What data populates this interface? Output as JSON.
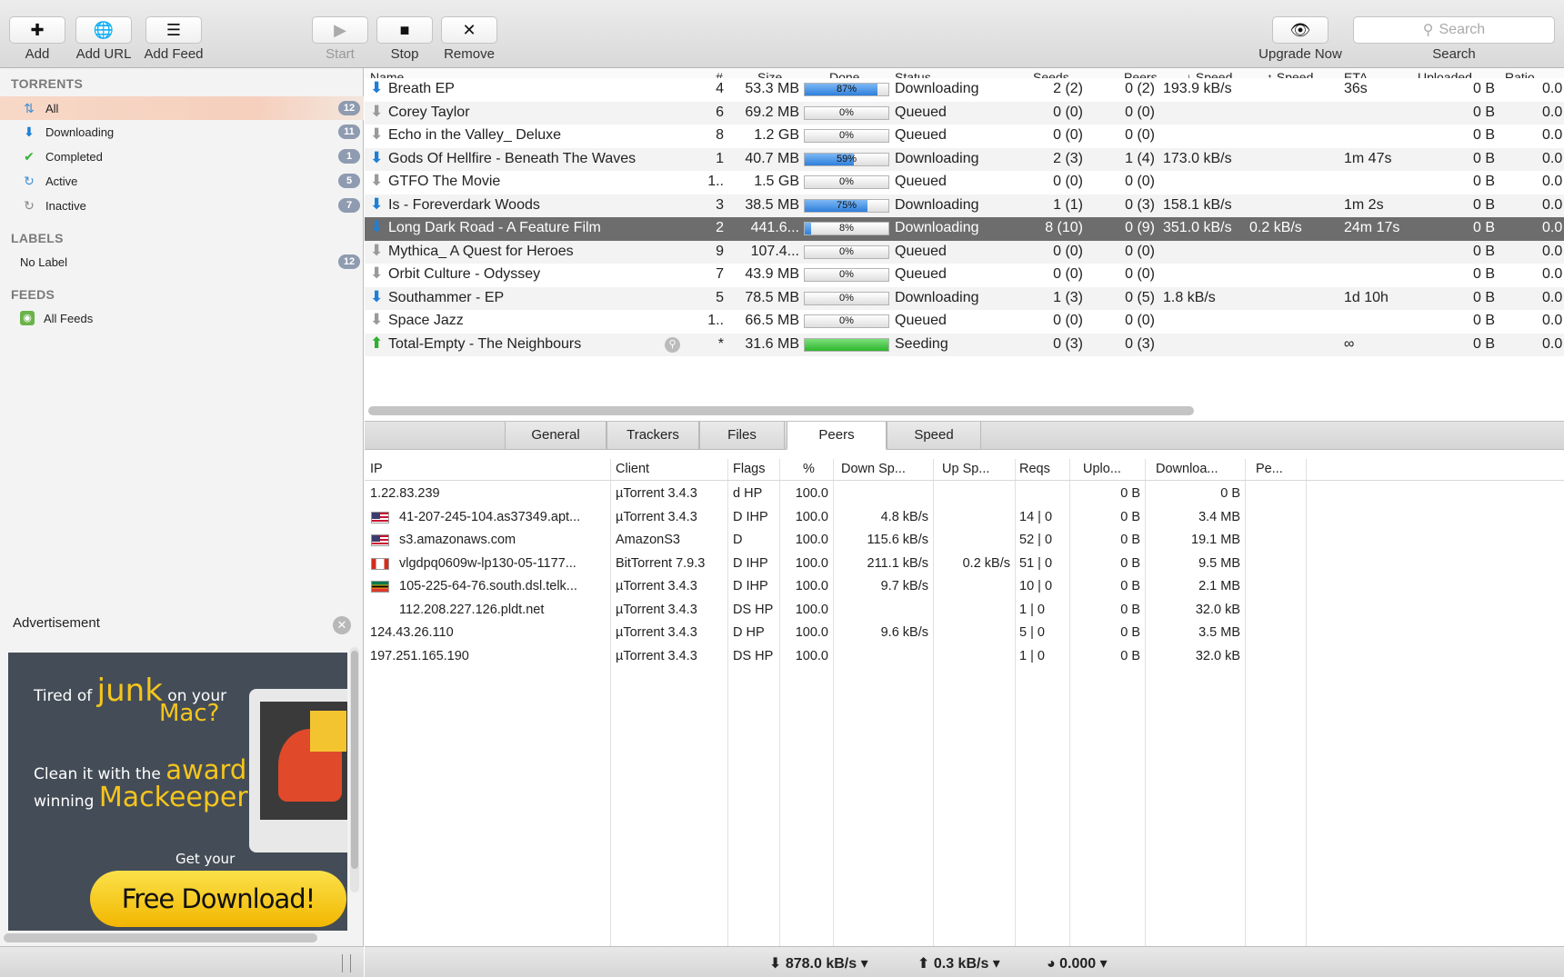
{
  "toolbar": {
    "add": "Add",
    "add_url": "Add URL",
    "add_feed": "Add Feed",
    "start": "Start",
    "stop": "Stop",
    "remove": "Remove",
    "upgrade": "Upgrade Now",
    "search_placeholder": "Search",
    "search_label": "Search"
  },
  "sidebar": {
    "torrents_header": "TORRENTS",
    "items": [
      {
        "label": "All",
        "count": "12",
        "icon": "all-arrows-icon"
      },
      {
        "label": "Downloading",
        "count": "11",
        "icon": "download-arrow-icon"
      },
      {
        "label": "Completed",
        "count": "1",
        "icon": "checkmark-icon"
      },
      {
        "label": "Active",
        "count": "5",
        "icon": "active-refresh-icon"
      },
      {
        "label": "Inactive",
        "count": "7",
        "icon": "inactive-refresh-icon"
      }
    ],
    "labels_header": "LABELS",
    "no_label": "No Label",
    "no_label_count": "12",
    "feeds_header": "FEEDS",
    "all_feeds": "All Feeds",
    "ad_label": "Advertisement",
    "ad": {
      "line1a": "Tired of",
      "line1b": "junk",
      "line1c": "on your",
      "line2": "Mac?",
      "line3a": "Clean it with the",
      "line3b": "award",
      "line4a": "winning",
      "line4b": "Mackeeper",
      "line5": "Get your",
      "button": "Free Download!"
    }
  },
  "torrents": {
    "headers": {
      "name": "Name",
      "num": "#",
      "size": "Size",
      "done": "Done",
      "status": "Status",
      "seeds": "Seeds",
      "peers": "Peers",
      "down": "↓ Speed",
      "up": "↑ Speed",
      "eta": "ETA",
      "uploaded": "Uploaded",
      "ratio": "Ratio"
    },
    "rows": [
      {
        "dir": "down",
        "name": "Breath EP",
        "num": "4",
        "size": "53.3 MB",
        "done": 87,
        "done_text": "87%",
        "status": "Downloading",
        "seeds": "2 (2)",
        "peers": "0 (2)",
        "down": "193.9 kB/s",
        "up": "",
        "eta": "36s",
        "uploaded": "0 B",
        "ratio": "0.0"
      },
      {
        "dir": "q",
        "name": "Corey Taylor",
        "num": "6",
        "size": "69.2 MB",
        "done": 0,
        "done_text": "0%",
        "status": "Queued",
        "seeds": "0 (0)",
        "peers": "0 (0)",
        "down": "",
        "up": "",
        "eta": "",
        "uploaded": "0 B",
        "ratio": "0.0"
      },
      {
        "dir": "q",
        "name": "Echo in the Valley_ Deluxe",
        "num": "8",
        "size": "1.2 GB",
        "done": 0,
        "done_text": "0%",
        "status": "Queued",
        "seeds": "0 (0)",
        "peers": "0 (0)",
        "down": "",
        "up": "",
        "eta": "",
        "uploaded": "0 B",
        "ratio": "0.0"
      },
      {
        "dir": "down",
        "name": "Gods Of Hellfire - Beneath The Waves",
        "num": "1",
        "size": "40.7 MB",
        "done": 59,
        "done_text": "59%",
        "status": "Downloading",
        "seeds": "2 (3)",
        "peers": "1 (4)",
        "down": "173.0 kB/s",
        "up": "",
        "eta": "1m 47s",
        "uploaded": "0 B",
        "ratio": "0.0"
      },
      {
        "dir": "q",
        "name": "GTFO The Movie",
        "num": "1..",
        "size": "1.5 GB",
        "done": 0,
        "done_text": "0%",
        "status": "Queued",
        "seeds": "0 (0)",
        "peers": "0 (0)",
        "down": "",
        "up": "",
        "eta": "",
        "uploaded": "0 B",
        "ratio": "0.0"
      },
      {
        "dir": "down",
        "name": "Is - Foreverdark Woods",
        "num": "3",
        "size": "38.5 MB",
        "done": 75,
        "done_text": "75%",
        "status": "Downloading",
        "seeds": "1 (1)",
        "peers": "0 (3)",
        "down": "158.1 kB/s",
        "up": "",
        "eta": "1m 2s",
        "uploaded": "0 B",
        "ratio": "0.0"
      },
      {
        "dir": "down",
        "name": "Long Dark Road - A Feature Film",
        "num": "2",
        "size": "441.6...",
        "done": 8,
        "done_text": "8%",
        "status": "Downloading",
        "seeds": "8 (10)",
        "peers": "0 (9)",
        "down": "351.0 kB/s",
        "up": "0.2 kB/s",
        "eta": "24m 17s",
        "uploaded": "0 B",
        "ratio": "0.0",
        "selected": true
      },
      {
        "dir": "q",
        "name": "Mythica_ A Quest for Heroes",
        "num": "9",
        "size": "107.4...",
        "done": 0,
        "done_text": "0%",
        "status": "Queued",
        "seeds": "0 (0)",
        "peers": "0 (0)",
        "down": "",
        "up": "",
        "eta": "",
        "uploaded": "0 B",
        "ratio": "0.0"
      },
      {
        "dir": "q",
        "name": "Orbit Culture - Odyssey",
        "num": "7",
        "size": "43.9 MB",
        "done": 0,
        "done_text": "0%",
        "status": "Queued",
        "seeds": "0 (0)",
        "peers": "0 (0)",
        "down": "",
        "up": "",
        "eta": "",
        "uploaded": "0 B",
        "ratio": "0.0"
      },
      {
        "dir": "down",
        "name": "Southammer - EP",
        "num": "5",
        "size": "78.5 MB",
        "done": 0,
        "done_text": "0%",
        "status": "Downloading",
        "seeds": "1 (3)",
        "peers": "0 (5)",
        "down": "1.8 kB/s",
        "up": "",
        "eta": "1d 10h",
        "uploaded": "0 B",
        "ratio": "0.0"
      },
      {
        "dir": "q",
        "name": "Space Jazz",
        "num": "1..",
        "size": "66.5 MB",
        "done": 0,
        "done_text": "0%",
        "status": "Queued",
        "seeds": "0 (0)",
        "peers": "0 (0)",
        "down": "",
        "up": "",
        "eta": "",
        "uploaded": "0 B",
        "ratio": "0.0"
      },
      {
        "dir": "up",
        "name": "Total-Empty - The Neighbours",
        "num": "*",
        "size": "31.6 MB",
        "done": 100,
        "done_text": "",
        "status": "Seeding",
        "seeds": "0 (3)",
        "peers": "0 (3)",
        "down": "",
        "up": "",
        "eta": "∞",
        "uploaded": "0 B",
        "ratio": "0.0"
      }
    ]
  },
  "tabs": [
    "General",
    "Trackers",
    "Files",
    "Peers",
    "Speed"
  ],
  "active_tab": "Peers",
  "peers": {
    "headers": {
      "ip": "IP",
      "client": "Client",
      "flags": "Flags",
      "pct": "%",
      "down": "Down Sp...",
      "up": "Up Sp...",
      "reqs": "Reqs",
      "uplo": "Uplo...",
      "downl": "Downloa...",
      "pe": "Pe..."
    },
    "rows": [
      {
        "flag": "",
        "ip": "1.22.83.239",
        "client": "µTorrent 3.4.3",
        "flags": "d HP",
        "pct": "100.0",
        "down": "",
        "up": "",
        "reqs": "",
        "uplo": "0 B",
        "downl": "0 B"
      },
      {
        "flag": "us",
        "ip": "41-207-245-104.as37349.apt...",
        "client": "µTorrent 3.4.3",
        "flags": "D IHP",
        "pct": "100.0",
        "down": "4.8 kB/s",
        "up": "",
        "reqs": "14 | 0",
        "uplo": "0 B",
        "downl": "3.4 MB"
      },
      {
        "flag": "us",
        "ip": "s3.amazonaws.com",
        "client": "AmazonS3",
        "flags": "D",
        "pct": "100.0",
        "down": "115.6 kB/s",
        "up": "",
        "reqs": "52 | 0",
        "uplo": "0 B",
        "downl": "19.1 MB"
      },
      {
        "flag": "ca",
        "ip": "vlgdpq0609w-lp130-05-1177...",
        "client": "BitTorrent 7.9.3",
        "flags": "D IHP",
        "pct": "100.0",
        "down": "211.1 kB/s",
        "up": "0.2 kB/s",
        "reqs": "51 | 0",
        "uplo": "0 B",
        "downl": "9.5 MB"
      },
      {
        "flag": "za",
        "ip": "105-225-64-76.south.dsl.telk...",
        "client": "µTorrent 3.4.3",
        "flags": "D IHP",
        "pct": "100.0",
        "down": "9.7 kB/s",
        "up": "",
        "reqs": "10 | 0",
        "uplo": "0 B",
        "downl": "2.1 MB"
      },
      {
        "flag": "blank",
        "ip": "112.208.227.126.pldt.net",
        "client": "µTorrent 3.4.3",
        "flags": "DS HP",
        "pct": "100.0",
        "down": "",
        "up": "",
        "reqs": "1 | 0",
        "uplo": "0 B",
        "downl": "32.0 kB"
      },
      {
        "flag": "",
        "ip": "124.43.26.110",
        "client": "µTorrent 3.4.3",
        "flags": "D HP",
        "pct": "100.0",
        "down": "9.6 kB/s",
        "up": "",
        "reqs": "5 | 0",
        "uplo": "0 B",
        "downl": "3.5 MB"
      },
      {
        "flag": "",
        "ip": "197.251.165.190",
        "client": "µTorrent 3.4.3",
        "flags": "DS HP",
        "pct": "100.0",
        "down": "",
        "up": "",
        "reqs": "1 | 0",
        "uplo": "0 B",
        "downl": "32.0 kB"
      }
    ]
  },
  "statusbar": {
    "down": "⬇ 878.0 kB/s ▾",
    "up": "⬆ 0.3 kB/s ▾",
    "ratio": "◕ 0.000 ▾"
  },
  "colors": {
    "accent": "#1e7fd6",
    "selected_row": "#6d6d6d",
    "sidebar_selected": "#f6cfbd",
    "ad_yellow": "#f5c51d"
  }
}
